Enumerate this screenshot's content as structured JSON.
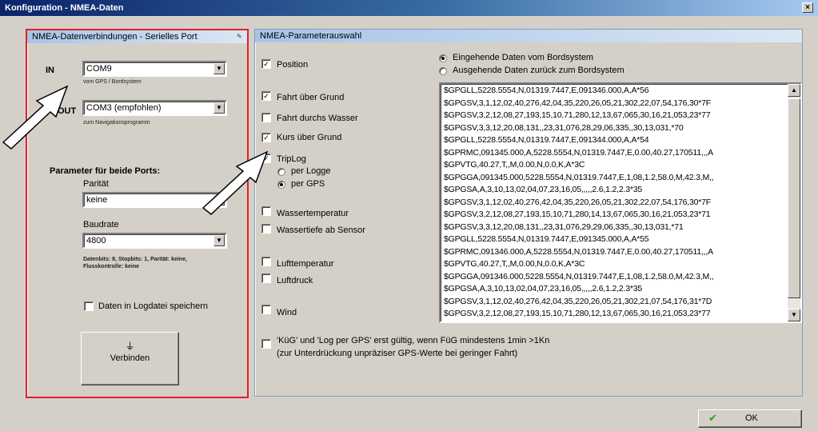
{
  "window": {
    "title": "Konfiguration - NMEA-Daten",
    "close_label": "×"
  },
  "left_panel": {
    "title": "NMEA-Datenverbindungen - Serielles Port",
    "in": {
      "label": "IN",
      "value": "COM9",
      "hint": "vom GPS / Bordsystem"
    },
    "out": {
      "label": "OUT",
      "value": "COM3 (empfohlen)",
      "hint": "zum Navigationsprogramm"
    },
    "params_heading": "Parameter für beide Ports:",
    "parity": {
      "label": "Parität",
      "value": "keine"
    },
    "baud": {
      "label": "Baudrate",
      "value": "4800"
    },
    "details": [
      "Datenbits: 8, Stopbits: 1, Parität: keine,",
      "Flusskontrolle: keine"
    ],
    "log_checkbox": {
      "label": "Daten in Logdatei speichern",
      "checked": false
    },
    "connect_button": {
      "label": "Verbinden",
      "icon": "connect-plug-icon"
    }
  },
  "right_panel": {
    "title": "NMEA-Parameterauswahl",
    "checkboxes": [
      {
        "id": "position",
        "label": "Position",
        "checked": true
      },
      {
        "id": "fahrt-grund",
        "label": "Fahrt über Grund",
        "checked": true
      },
      {
        "id": "fahrt-wasser",
        "label": "Fahrt durchs Wasser",
        "checked": false
      },
      {
        "id": "kurs-grund",
        "label": "Kurs über Grund",
        "checked": true
      },
      {
        "id": "triplog",
        "label": "TripLog",
        "checked": true
      },
      {
        "id": "wassertemp",
        "label": "Wassertemperatur",
        "checked": false
      },
      {
        "id": "wassertiefe",
        "label": "Wassertiefe ab Sensor",
        "checked": false
      },
      {
        "id": "lufttemp",
        "label": "Lufttemperatur",
        "checked": false
      },
      {
        "id": "luftdruck",
        "label": "Luftdruck",
        "checked": false
      },
      {
        "id": "wind",
        "label": "Wind",
        "checked": false
      }
    ],
    "triplog_options": [
      {
        "label": "per Logge",
        "selected": false
      },
      {
        "label": "per GPS",
        "selected": true
      }
    ],
    "source_options": [
      {
        "label": "Eingehende Daten vom Bordsystem",
        "selected": true
      },
      {
        "label": "Ausgehende Daten zurück zum Bordsystem",
        "selected": false
      }
    ],
    "nmea_lines": [
      "$GPGLL,5228.5554,N,01319.7447,E,091346.000,A,A*56",
      "$GPGSV,3,1,12,02,40,276,42,04,35,220,26,05,21,302,22,07,54,176,30*7F",
      "$GPGSV,3,2,12,08,27,193,15,10,71,280,12,13,67,065,30,16,21,053,23*77",
      "$GPGSV,3,3,12,20,08,131,,23,31,076,28,29,06,335,,30,13,031,*70",
      "$GPGLL,5228.5554,N,01319.7447,E,091344.000,A,A*54",
      "$GPRMC,091345.000,A,5228.5554,N,01319.7447,E,0.00,40.27,170511,,,A",
      "$GPVTG,40.27,T,,M,0.00,N,0.0,K,A*3C",
      "$GPGGA,091345.000,5228.5554,N,01319.7447,E,1,08,1.2,58.0,M,42.3,M,,",
      "$GPGSA,A,3,10,13,02,04,07,23,16,05,,,,,2.6,1.2,2.3*35",
      "$GPGSV,3,1,12,02,40,276,42,04,35,220,26,05,21,302,22,07,54,176,30*7F",
      "$GPGSV,3,2,12,08,27,193,15,10,71,280,14,13,67,065,30,16,21,053,23*71",
      "$GPGSV,3,3,12,20,08,131,,23,31,076,29,29,06,335,,30,13,031,*71",
      "$GPGLL,5228.5554,N,01319.7447,E,091345.000,A,A*55",
      "$GPRMC,091346.000,A,5228.5554,N,01319.7447,E,0.00,40.27,170511,,,A",
      "$GPVTG,40.27,T,,M,0.00,N,0.0,K,A*3C",
      "$GPGGA,091346.000,5228.5554,N,01319.7447,E,1,08,1.2,58.0,M,42.3,M,,",
      "$GPGSA,A,3,10,13,02,04,07,23,16,05,,,,,2.6,1.2,2.3*35",
      "$GPGSV,3,1,12,02,40,276,42,04,35,220,26,05,21,302,21,07,54,176,31*7D",
      "$GPGSV,3,2,12,08,27,193,15,10,71,280,12,13,67,065,30,16,21,053,23*77"
    ],
    "footnote_checkbox": {
      "checked": false,
      "line1": "'KüG' und 'Log per GPS' erst gültig, wenn FüG mindestens 1min >1Kn",
      "line2": "(zur Unterdrückung unpräziser GPS-Werte bei geringer Fahrt)"
    }
  },
  "ok_button": {
    "label": "OK",
    "icon": "green-check-icon"
  }
}
